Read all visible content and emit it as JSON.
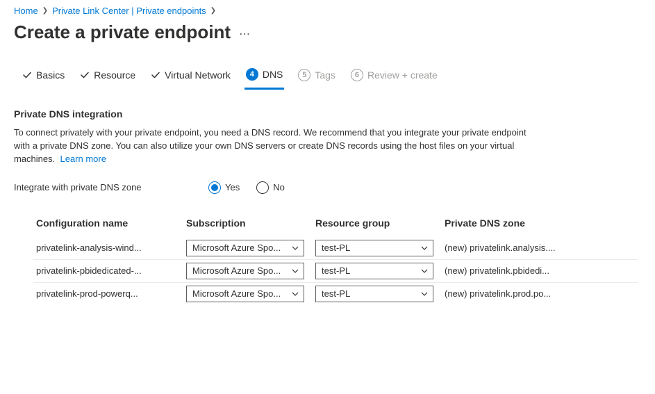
{
  "breadcrumb": {
    "items": [
      {
        "label": "Home"
      },
      {
        "label": "Private Link Center | Private endpoints"
      }
    ]
  },
  "page": {
    "title": "Create a private endpoint"
  },
  "tabs": [
    {
      "label": "Basics",
      "state": "done"
    },
    {
      "label": "Resource",
      "state": "done"
    },
    {
      "label": "Virtual Network",
      "state": "done"
    },
    {
      "label": "DNS",
      "state": "active",
      "number": "4"
    },
    {
      "label": "Tags",
      "state": "upcoming",
      "number": "5"
    },
    {
      "label": "Review + create",
      "state": "upcoming",
      "number": "6"
    }
  ],
  "section": {
    "title": "Private DNS integration",
    "description": "To connect privately with your private endpoint, you need a DNS record. We recommend that you integrate your private endpoint with a private DNS zone. You can also utilize your own DNS servers or create DNS records using the host files on your virtual machines.",
    "learn_more": "Learn more"
  },
  "field": {
    "label": "Integrate with private DNS zone",
    "yes": "Yes",
    "no": "No",
    "value": "yes"
  },
  "table": {
    "columns": {
      "config": "Configuration name",
      "subscription": "Subscription",
      "rg": "Resource group",
      "zone": "Private DNS zone"
    },
    "rows": [
      {
        "config": "privatelink-analysis-wind...",
        "subscription": "Microsoft Azure Spo...",
        "rg": "test-PL",
        "zone": "(new) privatelink.analysis...."
      },
      {
        "config": "privatelink-pbidedicated-...",
        "subscription": "Microsoft Azure Spo...",
        "rg": "test-PL",
        "zone": "(new) privatelink.pbidedi..."
      },
      {
        "config": "privatelink-prod-powerq...",
        "subscription": "Microsoft Azure Spo...",
        "rg": "test-PL",
        "zone": "(new) privatelink.prod.po..."
      }
    ]
  }
}
